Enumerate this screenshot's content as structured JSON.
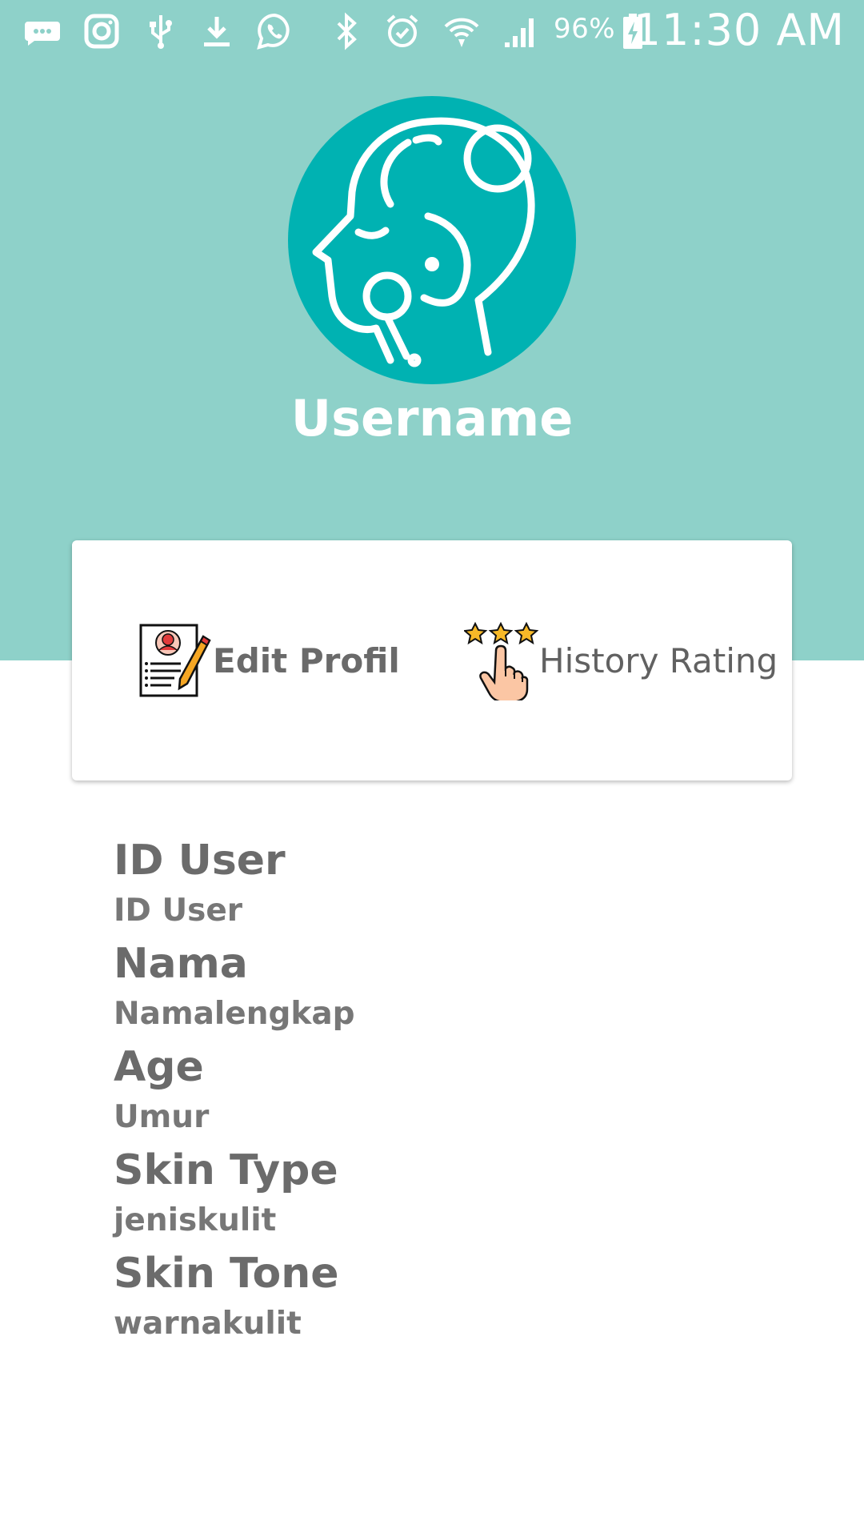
{
  "status_bar": {
    "battery_percent": "96%",
    "time": "11:30 AM",
    "icons": [
      "messages-icon",
      "instagram-icon",
      "usb-icon",
      "download-icon",
      "whatsapp-icon",
      "bluetooth-icon",
      "alarm-icon",
      "wifi-icon",
      "signal-icon",
      "battery-charging-icon"
    ]
  },
  "profile": {
    "username": "Username",
    "avatar_icon": "face-care-icon",
    "avatar_color": "#00b2b2",
    "header_color": "#8ed1c9"
  },
  "actions": {
    "edit_profile": {
      "label": "Edit Profil",
      "icon": "edit-profile-icon"
    },
    "history_rating": {
      "label": "History Rating",
      "icon": "rating-hand-icon"
    }
  },
  "info": {
    "id_user": {
      "label": "ID User",
      "value": "ID User"
    },
    "nama": {
      "label": "Nama",
      "value": "Namalengkap"
    },
    "age": {
      "label": "Age",
      "value": "Umur"
    },
    "skin_type": {
      "label": "Skin Type",
      "value": "jeniskulit"
    },
    "skin_tone": {
      "label": "Skin Tone",
      "value": "warnakulit"
    }
  }
}
